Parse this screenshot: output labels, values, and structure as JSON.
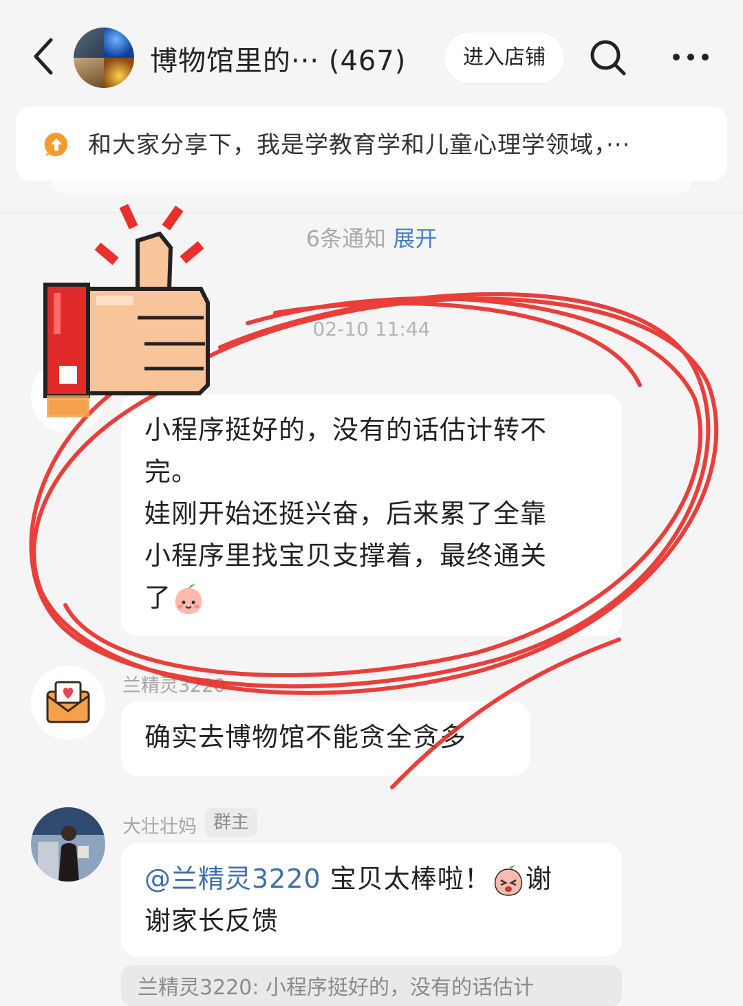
{
  "header": {
    "title": "博物馆里的··· (467)",
    "shop_button": "进入店铺"
  },
  "announcement": {
    "text": "和大家分享下，我是学教育学和儿童心理学领域，···"
  },
  "notifications": {
    "count_text": "6条通知",
    "expand_label": "展开"
  },
  "chat": {
    "timestamp": "02-10 11:44",
    "messages": [
      {
        "lines": [
          "小程序挺好的，没有的话估计转不",
          "完。",
          "娃刚开始还挺兴奋，后来累了全靠",
          "小程序里找宝贝支撑着，最终通关",
          "了"
        ]
      },
      {
        "sender": "兰精灵3220",
        "text": "确实去博物馆不能贪全贪多"
      },
      {
        "sender": "大壮壮妈",
        "role": "群主",
        "mention": "@兰精灵3220",
        "text_part1": " 宝贝太棒啦！",
        "text_part2": "谢",
        "text_line2": "谢家长反馈",
        "quote": "兰精灵3220: 小程序挺好的，没有的话估计"
      }
    ]
  },
  "colors": {
    "accent_blue": "#4a7ec4",
    "annotation_red": "#e8302c",
    "notice_orange": "#f39a2e"
  },
  "decorations": {
    "thumbs_up": "pixel-thumbs-up-sticker",
    "annotation": "red-hand-drawn-circle"
  }
}
